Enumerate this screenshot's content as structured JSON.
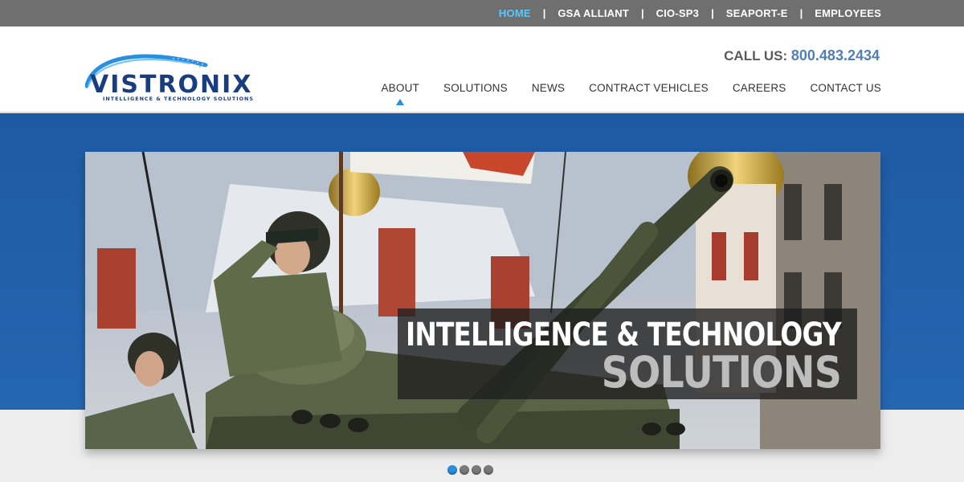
{
  "top_nav": {
    "links": [
      "HOME",
      "GSA ALLIANT",
      "CIO-SP3",
      "SEAPORT-E",
      "EMPLOYEES"
    ],
    "separator": "|",
    "active_index": 0
  },
  "brand": {
    "name": "VISTRONIX",
    "tagline": "INTELLIGENCE & TECHNOLOGY SOLUTIONS"
  },
  "contact": {
    "label": "CALL US:",
    "phone": "800.483.2434"
  },
  "main_nav": {
    "items": [
      "ABOUT",
      "SOLUTIONS",
      "NEWS",
      "CONTRACT VEHICLES",
      "CAREERS",
      "CONTACT US"
    ],
    "active_index": 0
  },
  "hero": {
    "line1": "INTELLIGENCE & TECHNOLOGY",
    "line2": "SOLUTIONS",
    "slide_count": 4,
    "active_slide": 0
  },
  "colors": {
    "top_bar": "#6f6f6f",
    "active_link": "#5bc7ff",
    "phone": "#4f7fb8",
    "hero_band": "#1f5fa8",
    "accent": "#2b8fe0"
  }
}
